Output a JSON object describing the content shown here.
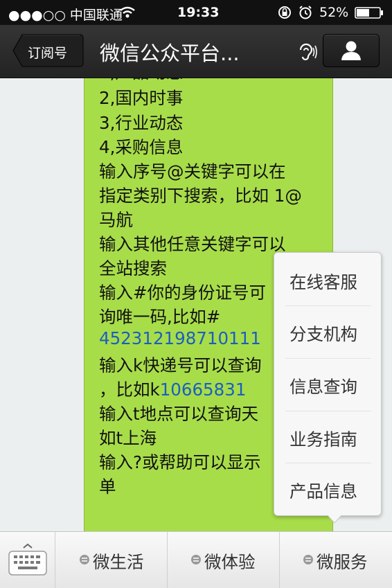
{
  "status": {
    "carrier": "●●●○○ 中国联通",
    "time": "19:33",
    "battery": "52%"
  },
  "nav": {
    "back_label": "订阅号",
    "title": "微信公众平台..."
  },
  "message": {
    "lines": [
      "2,国内时事",
      "3,行业动态",
      "4,采购信息",
      "输入序号@关键字可以在",
      "指定类别下搜索，比如 1@",
      "马航",
      "输入其他任意关键字可以",
      "全站搜索",
      "输入#你的身份证号可",
      "询唯一码,比如#",
      "452312198710111",
      "输入k快递号可以查询",
      "，比如k",
      "10665831",
      "输入t地点可以查询天",
      "如t上海",
      "输入?或帮助可以显示",
      "单"
    ]
  },
  "menu": {
    "items": [
      "在线客服",
      "分支机构",
      "信息查询",
      "业务指南",
      "产品信息"
    ]
  },
  "tabs": {
    "items": [
      "微生活",
      "微体验",
      "微服务"
    ]
  }
}
